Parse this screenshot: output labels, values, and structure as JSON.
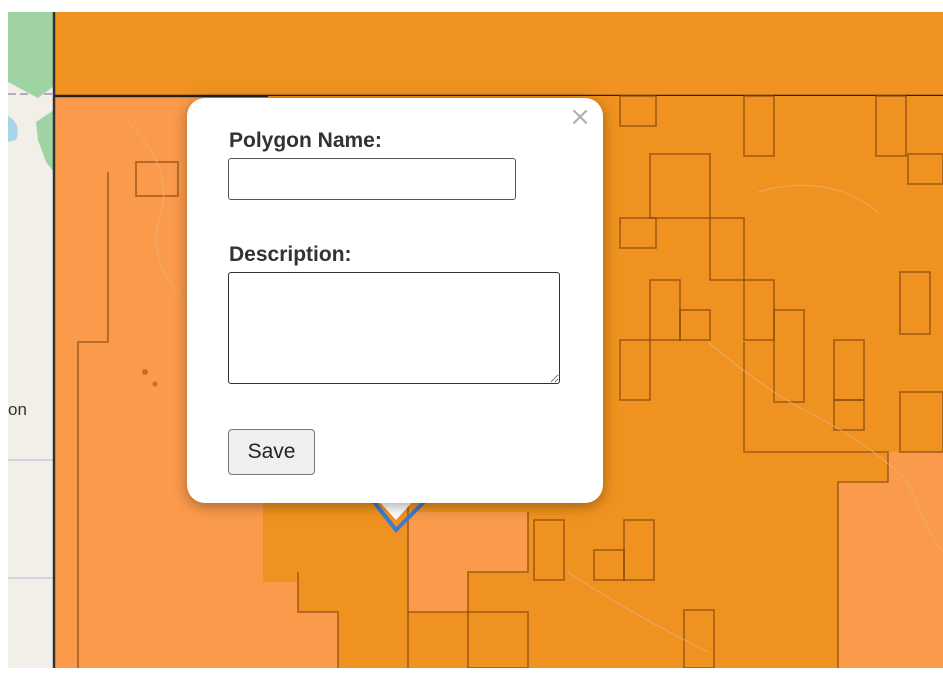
{
  "map": {
    "partial_label": "on",
    "colors": {
      "base": "#f2efe9",
      "light_orange": "#fb9a4b",
      "dark_orange": "#f0921f",
      "parcel_stroke": "#8a4a10",
      "boundary_line": "#222222",
      "polygon_outline": "#3a7bd5",
      "green_area": "#9fd3a4",
      "water": "#a9d3e8"
    }
  },
  "popup": {
    "close_symbol": "×",
    "name_label": "Polygon Name:",
    "name_value": "",
    "description_label": "Description:",
    "description_value": "",
    "save_label": "Save"
  }
}
